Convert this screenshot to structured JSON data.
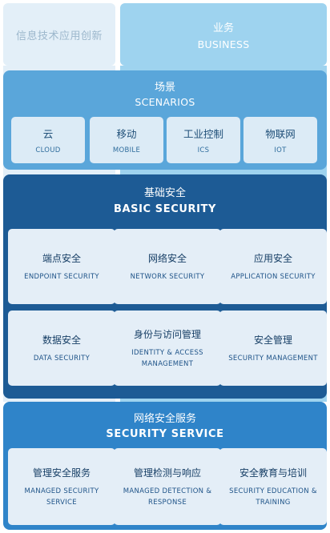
{
  "top": {
    "left_label": "信息技术应用创新",
    "right_zh": "业务",
    "right_en": "BUSINESS"
  },
  "scenarios": {
    "title_zh": "场景",
    "title_en": "SCENARIOS",
    "items": [
      {
        "zh": "云",
        "en": "CLOUD"
      },
      {
        "zh": "移动",
        "en": "MOBILE"
      },
      {
        "zh": "工业控制",
        "en": "ICS"
      },
      {
        "zh": "物联网",
        "en": "IOT"
      }
    ]
  },
  "basic_security": {
    "title_zh": "基础安全",
    "title_en": "BASIC SECURITY",
    "items": [
      {
        "zh": "端点安全",
        "en": "ENDPOINT SECURITY"
      },
      {
        "zh": "网络安全",
        "en": "NETWORK SECURITY"
      },
      {
        "zh": "应用安全",
        "en": "APPLICATION SECURITY"
      },
      {
        "zh": "数据安全",
        "en": "DATA SECURITY"
      },
      {
        "zh": "身份与访问管理",
        "en": "IDENTITY & ACCESS MANAGEMENT"
      },
      {
        "zh": "安全管理",
        "en": "SECURITY MANAGEMENT"
      }
    ]
  },
  "security_service": {
    "title_zh": "网络安全服务",
    "title_en": "SECURITY SERVICE",
    "items": [
      {
        "zh": "管理安全服务",
        "en": "MANAGED SECURITY SERVICE"
      },
      {
        "zh": "管理检测与响应",
        "en": "MANAGED DETECTION & RESPONSE"
      },
      {
        "zh": "安全教育与培训",
        "en": "SECURITY EDUCATION & TRAINING"
      }
    ]
  },
  "colors": {
    "pale_column": "#e3eff8",
    "business_column": "#9ed3ef",
    "scenarios_band": "#5aa6da",
    "basic_security_band": "#1d5b95",
    "security_service_band": "#2f84c9"
  }
}
